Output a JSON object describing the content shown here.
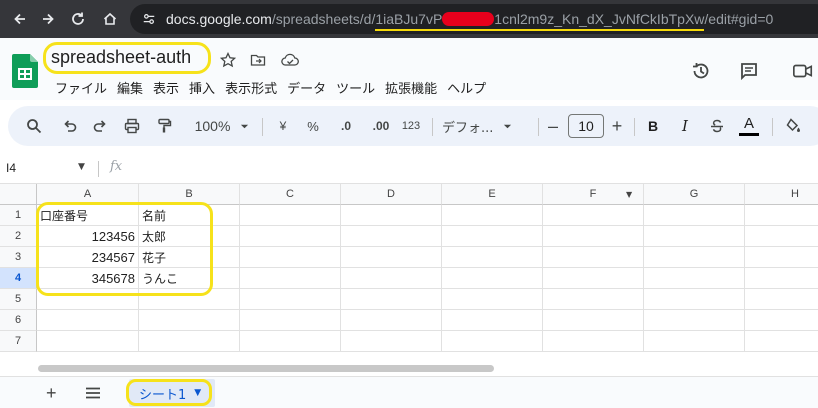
{
  "browser": {
    "url_host": "docs.google.com",
    "url_path": "/spreadsheets/d/",
    "url_id_start": "1iaBJu7vP",
    "url_id_end": "1cnl2m9z_Kn_dX_JvNfCkIbTpXw",
    "url_suffix": "/edit#gid=0"
  },
  "doc": {
    "title": "spreadsheet-auth",
    "menus": [
      "ファイル",
      "編集",
      "表示",
      "挿入",
      "表示形式",
      "データ",
      "ツール",
      "拡張機能",
      "ヘルプ"
    ]
  },
  "toolbar": {
    "zoom": "100%",
    "currency": "¥",
    "percent": "%",
    "dec_decrease": ".0",
    "dec_increase": ".00",
    "number_format": "123",
    "font": "デフォ...",
    "font_size": "10",
    "bold": "B",
    "italic": "I",
    "text_color": "A"
  },
  "formula_bar": {
    "cell_ref": "I4",
    "fx_label": "fx"
  },
  "grid": {
    "columns": [
      "A",
      "B",
      "C",
      "D",
      "E",
      "F",
      "G",
      "H"
    ],
    "rows": [
      "1",
      "2",
      "3",
      "4",
      "5",
      "6",
      "7"
    ],
    "cells": [
      [
        "口座番号",
        "名前"
      ],
      [
        "123456",
        "太郎"
      ],
      [
        "234567",
        "花子"
      ],
      [
        "345678",
        "うんこ"
      ]
    ]
  },
  "sheets": {
    "add_label": "+",
    "tabs": [
      "シート1"
    ]
  },
  "colors": {
    "highlight": "#f6e21b",
    "accent": "#0b57d0",
    "sheets_green": "#0f9d58"
  }
}
